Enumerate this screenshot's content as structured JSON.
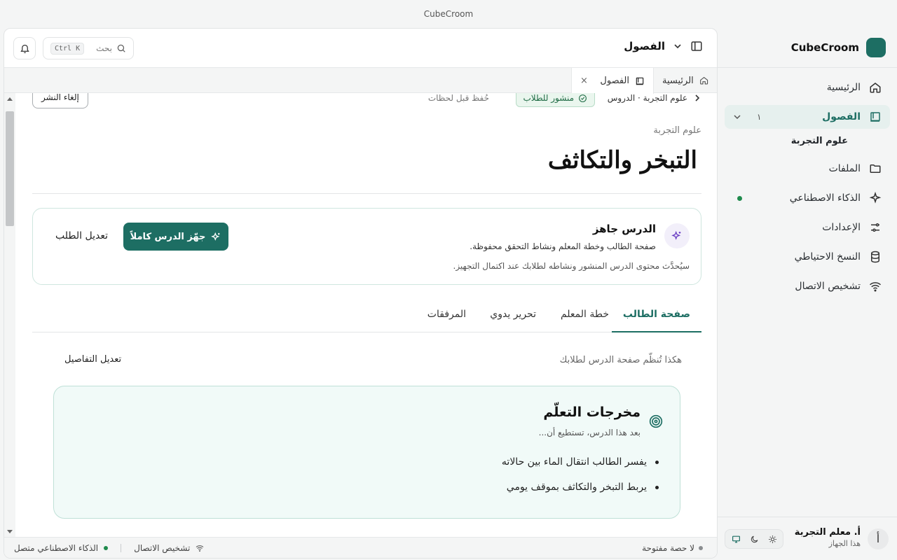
{
  "window": {
    "title": "CubeCroom"
  },
  "sidebar": {
    "brand": "CubeCroom",
    "items": [
      {
        "label": "الرئيسية",
        "icon": "home-icon"
      },
      {
        "label": "الفصول",
        "icon": "book-icon",
        "count": "١",
        "active": true
      },
      {
        "label": "الملفات",
        "icon": "folder-icon"
      },
      {
        "label": "الذكاء الاصطناعي",
        "icon": "sparkles-icon"
      },
      {
        "label": "الإعدادات",
        "icon": "sliders-icon"
      },
      {
        "label": "النسخ الاحتياطي",
        "icon": "database-icon"
      },
      {
        "label": "تشخيص الاتصال",
        "icon": "wifi-icon"
      }
    ],
    "sub_item": "علوم التجربة",
    "user": {
      "avatar": "أ",
      "name": "أ. معلم التجربة",
      "device": "هذا الجهاز"
    }
  },
  "topbar": {
    "title": "الفصول",
    "search_placeholder": "بحث",
    "shortcut": "Ctrl K"
  },
  "tabs": [
    {
      "label": "الرئيسية",
      "icon": "home-icon"
    },
    {
      "label": "الفصول",
      "icon": "book-icon",
      "close": "×"
    }
  ],
  "lesson": {
    "breadcrumb": "علوم التجربة · الدروس",
    "status_badge": "منشور للطلاب",
    "saved_text": "حُفظ قبل لحظات",
    "unpublish_label": "إلغاء النشر",
    "course": "علوم التجربة",
    "title": "التبخر والتكاثف"
  },
  "ready_card": {
    "title": "الدرس جاهز",
    "subtitle": "صفحة الطالب وخطة المعلم ونشاط التحقق محفوظة.",
    "note": "سيُحدَّث محتوى الدرس المنشور ونشاطه لطلابك عند اكتمال التجهيز.",
    "prepare_label": "جهّز الدرس كاملاً",
    "edit_request_label": "تعديل الطلب"
  },
  "content_tabs": [
    {
      "label": "صفحة الطالب",
      "active": true
    },
    {
      "label": "خطة المعلم"
    },
    {
      "label": "تحرير يدوي"
    },
    {
      "label": "المرفقات"
    }
  ],
  "student_page": {
    "intro": "هكذا تُنظّم صفحة الدرس لطلابك",
    "edit_details_label": "تعديل التفاصيل",
    "outcomes": {
      "title": "مخرجات التعلّم",
      "subtitle": "بعد هذا الدرس، تستطيع أن...",
      "items": [
        "يفسر الطالب انتقال الماء بين حالاته",
        "يربط التبخر والتكاثف بموقف يومي"
      ]
    }
  },
  "statusbar": {
    "session": "لا حصة مفتوحة",
    "diagnostics": "تشخيص الاتصال",
    "ai_status": "الذكاء الاصطناعي متصل"
  },
  "colors": {
    "accent": "#1d6e63",
    "success": "#1f8a4c"
  }
}
